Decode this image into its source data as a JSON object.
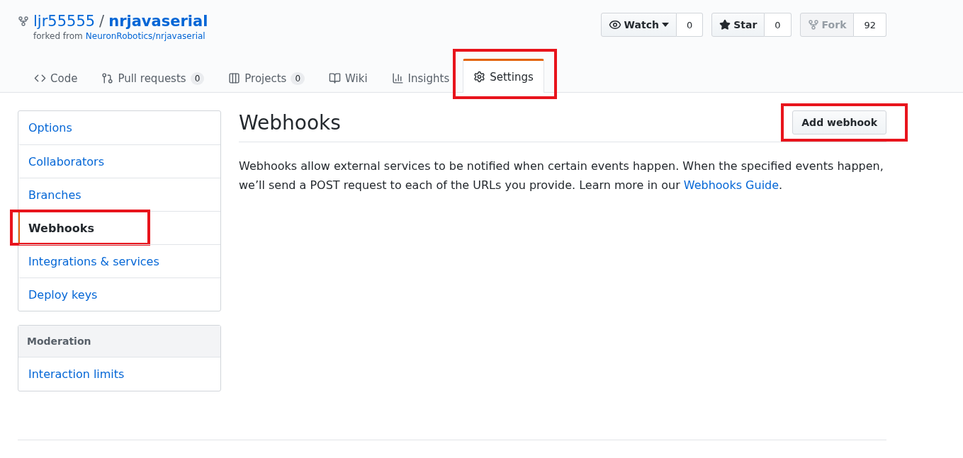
{
  "repo": {
    "owner": "ljr55555",
    "separator": "/",
    "name": "nrjavaserial",
    "fork_note": "forked from",
    "fork_source": "NeuronRobotics/nrjavaserial"
  },
  "actions": [
    {
      "kind": "watch",
      "label": "Watch",
      "count": "0",
      "disabled": false,
      "dropdown": true
    },
    {
      "kind": "star",
      "label": "Star",
      "count": "0",
      "disabled": false,
      "dropdown": false
    },
    {
      "kind": "fork",
      "label": "Fork",
      "count": "92",
      "disabled": true,
      "dropdown": false
    }
  ],
  "tabs": [
    {
      "kind": "code",
      "label": "Code",
      "selected": false,
      "highlighted": false
    },
    {
      "kind": "pulls",
      "label": "Pull requests",
      "counter": "0",
      "selected": false,
      "highlighted": false
    },
    {
      "kind": "projects",
      "label": "Projects",
      "counter": "0",
      "selected": false,
      "highlighted": false
    },
    {
      "kind": "wiki",
      "label": "Wiki",
      "selected": false,
      "highlighted": false
    },
    {
      "kind": "insights",
      "label": "Insights",
      "selected": false,
      "highlighted": false
    },
    {
      "kind": "settings",
      "label": "Settings",
      "selected": true,
      "highlighted": true
    }
  ],
  "sidebar": {
    "items": [
      {
        "label": "Options",
        "selected": false,
        "highlighted": false
      },
      {
        "label": "Collaborators",
        "selected": false,
        "highlighted": false
      },
      {
        "label": "Branches",
        "selected": false,
        "highlighted": false
      },
      {
        "label": "Webhooks",
        "selected": true,
        "highlighted": true
      },
      {
        "label": "Integrations & services",
        "selected": false,
        "highlighted": false
      },
      {
        "label": "Deploy keys",
        "selected": false,
        "highlighted": false
      }
    ],
    "moderation": {
      "heading": "Moderation",
      "items": [
        {
          "label": "Interaction limits",
          "selected": false,
          "highlighted": false
        }
      ]
    }
  },
  "main": {
    "title": "Webhooks",
    "add_button": {
      "label": "Add webhook",
      "highlighted": true
    },
    "description": "Webhooks allow external services to be notified when certain events happen. When the specified events happen, we’ll send a POST request to each of the URLs you provide. Learn more in our",
    "link": "Webhooks Guide",
    "description_end": "."
  }
}
